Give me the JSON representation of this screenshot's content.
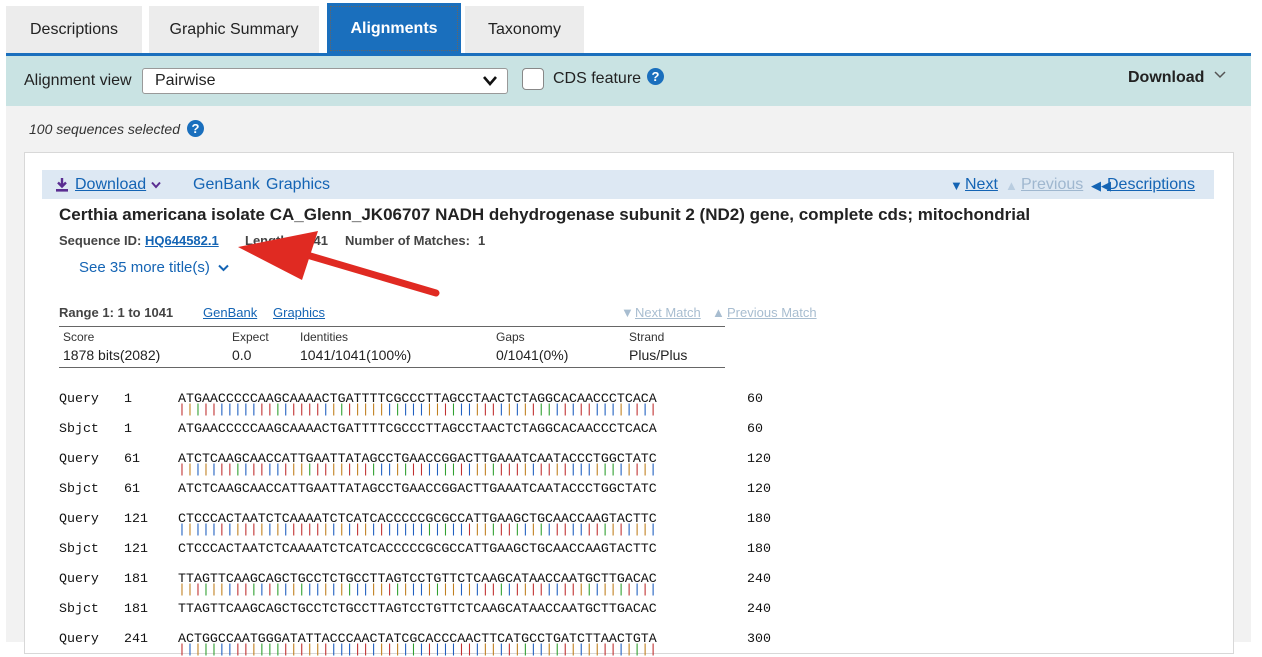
{
  "tabs": [
    "Descriptions",
    "Graphic Summary",
    "Alignments",
    "Taxonomy"
  ],
  "toolbar": {
    "alignment_view_label": "Alignment view",
    "alignment_view_value": "Pairwise",
    "cds_label": "CDS feature",
    "help_glyph": "?",
    "download_label": "Download"
  },
  "selected": "100 sequences selected",
  "card_header": {
    "download": "Download",
    "genbank": "GenBank",
    "graphics": "Graphics",
    "next": "Next",
    "previous": "Previous",
    "descriptions": "Descriptions"
  },
  "hit": {
    "title": "Certhia americana isolate CA_Glenn_JK06707 NADH dehydrogenase subunit 2 (ND2) gene, complete cds; mitochondrial",
    "seq_id_label": "Sequence ID:",
    "seq_id": "HQ644582.1",
    "length_label": "Length:",
    "length": "1041",
    "matches_label": "Number of Matches:",
    "matches": "1",
    "see_more": "See 35 more title(s)"
  },
  "range": {
    "label": "Range 1: 1 to 1041",
    "genbank": "GenBank",
    "graphics": "Graphics",
    "next_match": "Next Match",
    "previous_match": "Previous Match"
  },
  "stats": {
    "headers": [
      "Score",
      "Expect",
      "Identities",
      "Gaps",
      "Strand"
    ],
    "values": [
      "1878 bits(2082)",
      "0.0",
      "1041/1041(100%)",
      "0/1041(0%)",
      "Plus/Plus"
    ]
  },
  "alignment": [
    {
      "start": "1",
      "seq": "ATGAACCCCCAAGCAAAACTGATTTTCGCCCTTAGCCTAACTCTAGGCACAACCCTCACA",
      "end": "60"
    },
    {
      "start": "61",
      "seq": "ATCTCAAGCAACCATTGAATTATAGCCTGAACCGGACTTGAAATCAATACCCTGGCTATC",
      "end": "120"
    },
    {
      "start": "121",
      "seq": "CTCCCACTAATCTCAAAATCTCATCACCCCCGCGCCATTGAAGCTGCAACCAAGTACTTC",
      "end": "180"
    },
    {
      "start": "181",
      "seq": "TTAGTTCAAGCAGCTGCCTCTGCCTTAGTCCTGTTCTCAAGCATAACCAATGCTTGACAC",
      "end": "240"
    },
    {
      "start": "241",
      "seq": "ACTGGCCAATGGGATATTACCCAACTATCGCACCCAACTTCATGCCTGATCTTAACTGTA",
      "end": "300"
    }
  ],
  "labels": {
    "query": "Query",
    "sbjct": "Sbjct"
  },
  "colors": {
    "nav_blue": "#1a6fbd",
    "toolbar_teal": "#c9e3e3",
    "link": "#1464b4",
    "arrow": "#e02a22"
  }
}
